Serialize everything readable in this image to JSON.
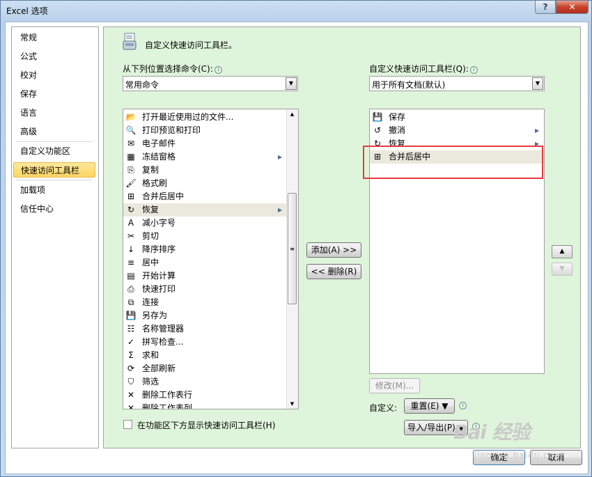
{
  "window": {
    "title": "Excel 选项",
    "help_label": "?",
    "close_label": "✕"
  },
  "nav": {
    "items": [
      {
        "label": "常规"
      },
      {
        "label": "公式"
      },
      {
        "label": "校对"
      },
      {
        "label": "保存"
      },
      {
        "label": "语言"
      },
      {
        "label": "高级"
      },
      {
        "label": "自定义功能区"
      },
      {
        "label": "快速访问工具栏",
        "active": true
      },
      {
        "label": "加载项"
      },
      {
        "label": "信任中心"
      }
    ]
  },
  "header": {
    "title": "自定义快速访问工具栏。",
    "icon": "toolbar-icon"
  },
  "left_panel": {
    "label": "从下列位置选择命令(C):",
    "dropdown_value": "常用命令",
    "commands": [
      {
        "label": "打开最近使用过的文件...",
        "icon": "open-recent-icon"
      },
      {
        "label": "打印预览和打印",
        "icon": "print-preview-icon"
      },
      {
        "label": "电子邮件",
        "icon": "email-icon"
      },
      {
        "label": "冻结窗格",
        "icon": "freeze-panes-icon",
        "submenu": true
      },
      {
        "label": "复制",
        "icon": "copy-icon"
      },
      {
        "label": "格式刷",
        "icon": "format-painter-icon"
      },
      {
        "label": "合并后居中",
        "icon": "merge-center-icon"
      },
      {
        "label": "恢复",
        "icon": "redo-icon",
        "submenu": true,
        "selected": true
      },
      {
        "label": "减小字号",
        "icon": "decrease-font-icon"
      },
      {
        "label": "剪切",
        "icon": "cut-icon"
      },
      {
        "label": "降序排序",
        "icon": "sort-desc-icon"
      },
      {
        "label": "居中",
        "icon": "center-icon"
      },
      {
        "label": "开始计算",
        "icon": "calculate-icon"
      },
      {
        "label": "快速打印",
        "icon": "quick-print-icon"
      },
      {
        "label": "连接",
        "icon": "connections-icon"
      },
      {
        "label": "另存为",
        "icon": "save-as-icon"
      },
      {
        "label": "名称管理器",
        "icon": "name-manager-icon"
      },
      {
        "label": "拼写检查...",
        "icon": "spelling-icon"
      },
      {
        "label": "求和",
        "icon": "sum-icon"
      },
      {
        "label": "全部刷新",
        "icon": "refresh-all-icon"
      },
      {
        "label": "筛选",
        "icon": "filter-icon"
      },
      {
        "label": "删除工作表行",
        "icon": "delete-rows-icon"
      },
      {
        "label": "删除工作表列",
        "icon": "delete-columns-icon"
      }
    ]
  },
  "right_panel": {
    "label": "自定义快速访问工具栏(Q):",
    "dropdown_value": "用于所有文档(默认)",
    "items": [
      {
        "label": "保存",
        "icon": "save-icon"
      },
      {
        "label": "撤消",
        "icon": "undo-icon",
        "submenu": true
      },
      {
        "label": "恢复",
        "icon": "redo-icon",
        "submenu": true
      },
      {
        "label": "合并后居中",
        "icon": "merge-center-icon",
        "selected": true
      }
    ]
  },
  "buttons": {
    "add": "添加(A) >>",
    "remove": "<< 删除(R)",
    "modify": "修改(M)...",
    "customize_label": "自定义:",
    "reset": "重置(E) ▼",
    "import_export": "导入/导出(P) ▼",
    "ok": "确定",
    "cancel": "取消",
    "move_up": "▲",
    "move_down": "▼"
  },
  "checkbox": {
    "label": "在功能区下方显示快速访问工具栏(H)",
    "checked": false
  },
  "watermark": {
    "logo": "Bai 经验",
    "sub": "jingyan.baidu.com"
  },
  "colors": {
    "content_bg": "#dff5db",
    "active_nav": "#fcd562",
    "highlight": "#e8393e"
  }
}
